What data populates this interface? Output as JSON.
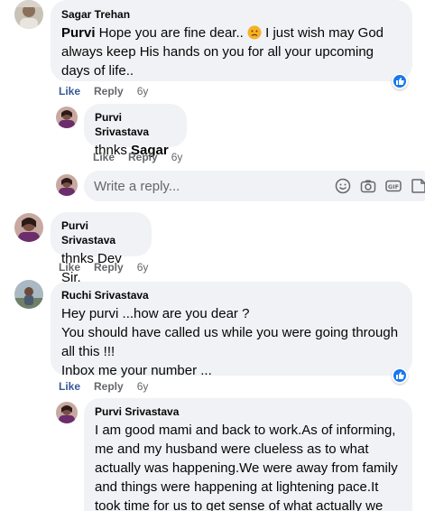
{
  "colors": {
    "like": "#385898",
    "muted": "#65676b",
    "bubble": "#f0f2f5",
    "reaction": "#1877f2"
  },
  "comments": [
    {
      "author": "Sagar Trehan",
      "mention": "Purvi",
      "text_before_emoji": " Hope you are fine dear.. ",
      "emoji": "sad-face-emoji",
      "text_after_emoji": " I just wish may God always keep His hands on you for all your upcoming days of life..",
      "like": "Like",
      "reply": "Reply",
      "time": "6y",
      "reaction": "like-reaction"
    },
    {
      "author": "Purvi Srivastava",
      "text": "thnks ",
      "mention": "Sagar",
      "like": "Like",
      "reply": "Reply",
      "time": "6y"
    },
    {
      "author": "Purvi Srivastava",
      "text": "thnks Dev Sir.",
      "like": "Like",
      "reply": "Reply",
      "time": "6y"
    },
    {
      "author": "Ruchi Srivastava",
      "lines": [
        "Hey purvi ...how are you dear ?",
        "You should have called us while you were going through all this !!!",
        "Inbox me your number ..."
      ],
      "like": "Like",
      "reply": "Reply",
      "time": "6y",
      "reaction": "like-reaction"
    },
    {
      "author": "Purvi Srivastava",
      "text": "I am good mami and back to work.As of informing, me and my husband were clueless as to what actually was happening.We were away from family and things were happening at lightening pace.It took time for us to get sense of what actually we"
    }
  ],
  "composer": {
    "placeholder": "Write a reply...",
    "tools": [
      "emoji-icon",
      "camera-icon",
      "gif-icon",
      "sticker-icon"
    ]
  }
}
